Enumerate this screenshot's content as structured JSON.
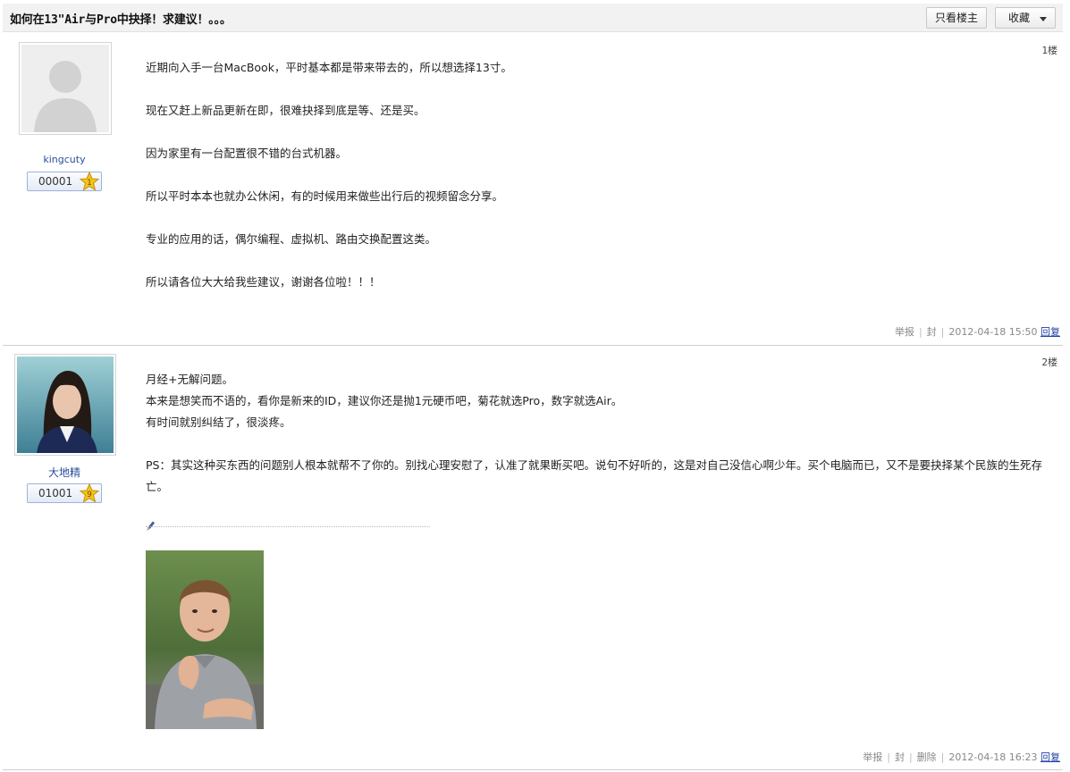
{
  "thread": {
    "title": "如何在13\"Air与Pro中抉择！求建议！。。。",
    "only_host_label": "只看楼主",
    "favorite_label": "收藏"
  },
  "posts": [
    {
      "floor": "1楼",
      "user": "kingcuty",
      "points": "00001",
      "level": "1",
      "paragraphs": [
        "近期向入手一台MacBook，平时基本都是带来带去的，所以想选择13寸。",
        "现在又赶上新品更新在即，很难抉择到底是等、还是买。",
        "因为家里有一台配置很不错的台式机器。",
        "所以平时本本也就办公休闲，有的时候用来做些出行后的视频留念分享。",
        "专业的应用的话，偶尔编程、虚拟机、路由交换配置这类。",
        "所以请各位大大给我些建议，谢谢各位啦！！！"
      ],
      "footer": {
        "report": "举报",
        "ban": "封",
        "time": "2012-04-18 15:50",
        "reply": "回复"
      }
    },
    {
      "floor": "2楼",
      "user": "大地精",
      "points": "01001",
      "level": "9",
      "lines": [
        "月经+无解问题。",
        "本来是想笑而不语的，看你是新来的ID，建议你还是抛1元硬币吧，菊花就选Pro，数字就选Air。",
        "有时间就别纠结了，很淡疼。"
      ],
      "ps": "PS：其实这种买东西的问题别人根本就帮不了你的。别找心理安慰了，认准了就果断买吧。说句不好听的，这是对自己没信心啊少年。买个电脑而已，又不是要抉择某个民族的生死存亡。",
      "footer": {
        "report": "举报",
        "ban": "封",
        "delete": "删除",
        "time": "2012-04-18 16:23",
        "reply": "回复"
      }
    }
  ],
  "colors": {
    "link": "#1f3fa8",
    "username": "#2b4e9b",
    "topbar_bg": "#f2f2f2",
    "star": "#f5c518"
  }
}
